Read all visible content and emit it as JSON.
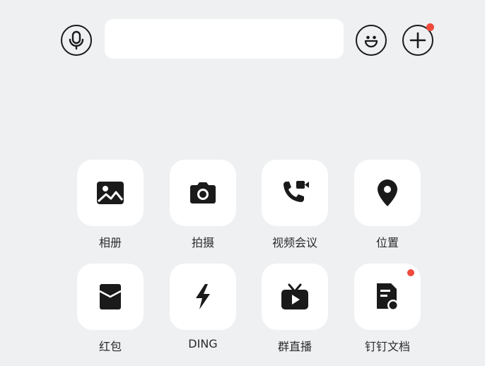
{
  "input_bar": {
    "voice_icon": "microphone-icon",
    "text_value": "",
    "emoji_icon": "smiley-icon",
    "more_icon": "plus-icon",
    "more_badge_color": "#f04a3c"
  },
  "actions": [
    {
      "label": "相册",
      "icon": "photo-icon"
    },
    {
      "label": "拍摄",
      "icon": "camera-icon"
    },
    {
      "label": "视频会议",
      "icon": "video-call-icon"
    },
    {
      "label": "位置",
      "icon": "location-pin-icon"
    },
    {
      "label": "红包",
      "icon": "red-envelope-icon"
    },
    {
      "label": "DING",
      "icon": "lightning-icon"
    },
    {
      "label": "群直播",
      "icon": "tv-live-icon"
    },
    {
      "label": "钉钉文档",
      "icon": "document-icon",
      "badge": true
    }
  ],
  "colors": {
    "background": "#eef0f2",
    "tile": "#ffffff",
    "icon": "#1a1a1a",
    "badge": "#f04a3c"
  }
}
